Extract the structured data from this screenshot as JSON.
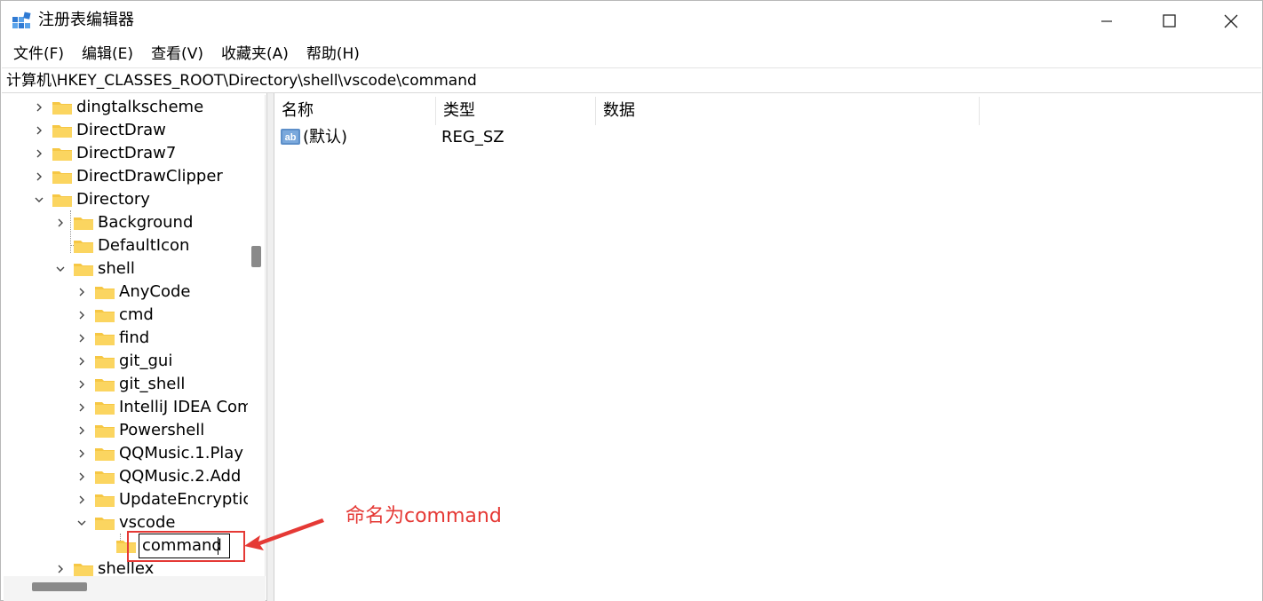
{
  "window": {
    "title": "注册表编辑器"
  },
  "menu": [
    "文件(F)",
    "编辑(E)",
    "查看(V)",
    "收藏夹(A)",
    "帮助(H)"
  ],
  "address": "计算机\\HKEY_CLASSES_ROOT\\Directory\\shell\\vscode\\command",
  "tree": [
    {
      "label": "dingtalkscheme",
      "level": 1,
      "state": "collapsed"
    },
    {
      "label": "DirectDraw",
      "level": 1,
      "state": "collapsed"
    },
    {
      "label": "DirectDraw7",
      "level": 1,
      "state": "collapsed"
    },
    {
      "label": "DirectDrawClipper",
      "level": 1,
      "state": "collapsed"
    },
    {
      "label": "Directory",
      "level": 1,
      "state": "expanded"
    },
    {
      "label": "Background",
      "level": 2,
      "state": "collapsed"
    },
    {
      "label": "DefaultIcon",
      "level": 2,
      "state": "leaf"
    },
    {
      "label": "shell",
      "level": 2,
      "state": "expanded"
    },
    {
      "label": "AnyCode",
      "level": 3,
      "state": "collapsed"
    },
    {
      "label": "cmd",
      "level": 3,
      "state": "collapsed"
    },
    {
      "label": "find",
      "level": 3,
      "state": "collapsed"
    },
    {
      "label": "git_gui",
      "level": 3,
      "state": "collapsed"
    },
    {
      "label": "git_shell",
      "level": 3,
      "state": "collapsed"
    },
    {
      "label": "IntelliJ IDEA Com",
      "level": 3,
      "state": "collapsed"
    },
    {
      "label": "Powershell",
      "level": 3,
      "state": "collapsed"
    },
    {
      "label": "QQMusic.1.Play",
      "level": 3,
      "state": "collapsed"
    },
    {
      "label": "QQMusic.2.Add",
      "level": 3,
      "state": "collapsed"
    },
    {
      "label": "UpdateEncryptic",
      "level": 3,
      "state": "collapsed"
    },
    {
      "label": "vscode",
      "level": 3,
      "state": "expanded"
    },
    {
      "label": "",
      "level": 4,
      "state": "editing"
    },
    {
      "label": "shellex",
      "level": 2,
      "state": "collapsed"
    }
  ],
  "edit_value": "command",
  "list": {
    "columns": [
      "名称",
      "类型",
      "数据"
    ],
    "rows": [
      {
        "name": "(默认)",
        "type": "REG_SZ",
        "data": ""
      }
    ]
  },
  "annotation": {
    "text": "命名为command",
    "color": "#e53935"
  },
  "colors": {
    "folder": "#f6c744",
    "accent": "#0067c0"
  }
}
